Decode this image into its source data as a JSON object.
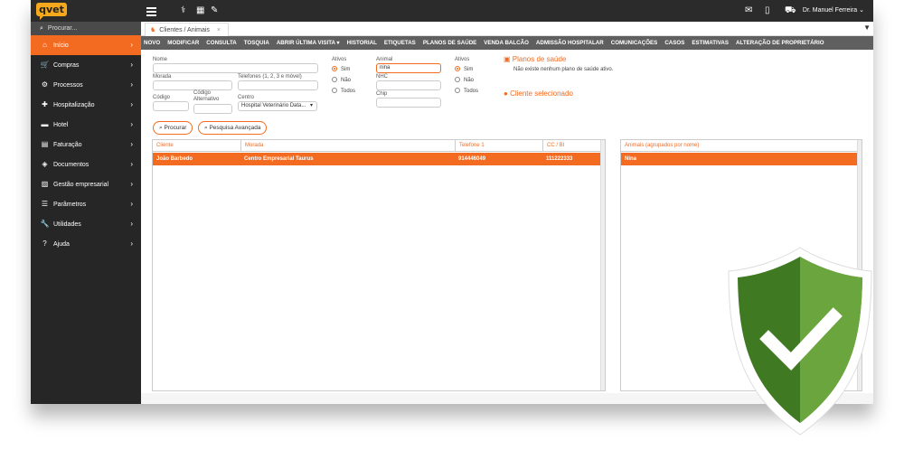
{
  "app": {
    "logo": "qvet",
    "user": "Dr. Manuel Ferreira ⌄"
  },
  "sidebar": {
    "search_label": "Procurar...",
    "items": [
      {
        "label": "Início",
        "icon": "home-icon",
        "glyph": "⌂"
      },
      {
        "label": "Compras",
        "icon": "cart-icon",
        "glyph": "🛒"
      },
      {
        "label": "Processos",
        "icon": "gear-icon",
        "glyph": "⚙"
      },
      {
        "label": "Hospitalização",
        "icon": "medkit-icon",
        "glyph": "✚"
      },
      {
        "label": "Hotel",
        "icon": "bed-icon",
        "glyph": "▬"
      },
      {
        "label": "Faturação",
        "icon": "invoice-icon",
        "glyph": "▤"
      },
      {
        "label": "Documentos",
        "icon": "layers-icon",
        "glyph": "◈"
      },
      {
        "label": "Gestão empresarial",
        "icon": "chart-icon",
        "glyph": "▨"
      },
      {
        "label": "Parâmetros",
        "icon": "sliders-icon",
        "glyph": "☰"
      },
      {
        "label": "Utilidades",
        "icon": "wrench-icon",
        "glyph": "🔧"
      },
      {
        "label": "Ajuda",
        "icon": "help-icon",
        "glyph": "?"
      }
    ]
  },
  "tab": {
    "label": "Clientes / Animais",
    "close": "×"
  },
  "menu": [
    "NOVO",
    "MODIFICAR",
    "CONSULTA",
    "TOSQUIA",
    "ABRIR ÚLTIMA VISITA ▾",
    "HISTORIAL",
    "ETIQUETAS",
    "PLANOS DE SAÚDE",
    "VENDA BALCÃO",
    "ADMISSÃO HOSPITALAR",
    "COMUNICAÇÕES",
    "CASOS",
    "ESTIMATIVAS",
    "ALTERAÇÃO DE PROPRIETÁRIO"
  ],
  "form": {
    "nome_label": "Nome",
    "morada_label": "Morada",
    "telefones_label": "Telefones (1, 2, 3 e móvel)",
    "codigo_label": "Código",
    "codigo_alt_label": "Código Alternativo",
    "centro_label": "Centro",
    "centro_value": "Hospital Veterinário Data...",
    "ativos_label": "Ativos",
    "radio_sim": "Sim",
    "radio_nao": "Não",
    "radio_todos": "Todos",
    "animal_label": "Animal",
    "animal_value": "nina",
    "nhc_label": "NHC",
    "chip_label": "Chip",
    "ativos2_label": "Ativos"
  },
  "planos": {
    "title": "Planos de saúde",
    "message": "Não existe nenhum plano de saúde ativo."
  },
  "cliente_selecionado": "Cliente selecionado",
  "buttons": {
    "procurar": "Procurar",
    "pesquisa": "Pesquisa Avançada"
  },
  "clients_table": {
    "headers": [
      "Cliente",
      "Morada",
      "Telefone 1",
      "CC / BI"
    ],
    "rows": [
      [
        "João Barbedo",
        "Centro Empresarial Taurus",
        "914446049",
        "111222333"
      ]
    ]
  },
  "animals_table": {
    "headers": [
      "Animais (agrupados por nome)"
    ],
    "rows": [
      [
        "Nina"
      ]
    ]
  },
  "colors": {
    "accent": "#f26b21",
    "logo": "#f6a81c",
    "shield_green": "#4f8a2b"
  }
}
